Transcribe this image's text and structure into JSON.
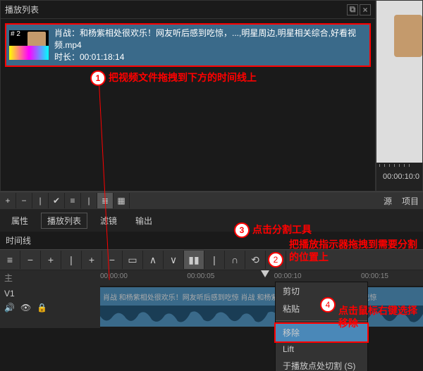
{
  "playlist": {
    "title": "播放列表",
    "item": {
      "hash": "# 2",
      "title": "肖战：和杨紫相处很欢乐！网友听后感到吃惊，...,明星周边,明星相关综合,好看视频.mp4",
      "duration_label": "时长：00:01:18:14"
    }
  },
  "preview": {
    "timecode": "00:00:10:0"
  },
  "mid_toolbar": {
    "right": {
      "source": "源",
      "project": "项目"
    }
  },
  "tabs": {
    "attrs": "属性",
    "playlist": "播放列表",
    "filter": "滤镜",
    "export": "输出"
  },
  "timeline": {
    "title": "时间线",
    "main_label": "主",
    "track1": "V1",
    "ruler": [
      "00:00:00",
      "00:00:05",
      "00:00:10",
      "00:00:15"
    ],
    "clip_text": "肖战  和杨紫相处很欢乐！网友听后感到吃惊  肖战 和杨紫相处很欢乐！网友听后感到吃惊"
  },
  "context_menu": {
    "cut": "剪切",
    "paste": "粘贴",
    "remove": "移除",
    "lift": "Lift",
    "split_at_playhead": "于播放点处切割 (S)"
  },
  "annotations": {
    "a1": "把视频文件拖拽到下方的时间线上",
    "a3": "点击分割工具",
    "a2": "把播放指示器拖拽到需要分割的位置上",
    "a4": "点击鼠标右键选择移除"
  }
}
